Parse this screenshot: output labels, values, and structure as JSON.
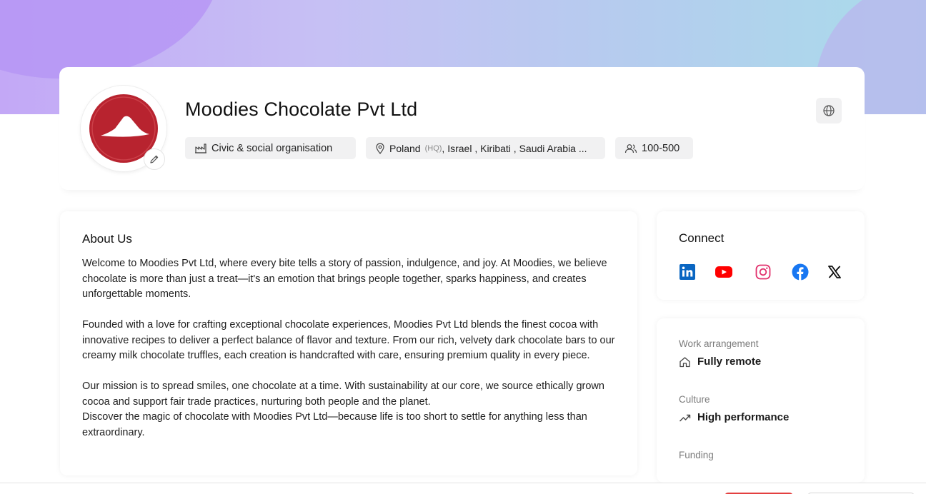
{
  "company": {
    "name": "Moodies Chocolate Pvt Ltd",
    "industry": "Civic & social organisation",
    "locations": {
      "primary": "Poland",
      "hq_tag": "(HQ)",
      "others": ", Israel , Kiribati , Saudi Arabia ..."
    },
    "size": "100-500"
  },
  "about": {
    "title": "About Us",
    "paragraphs": [
      "Welcome to Moodies Pvt Ltd, where every bite tells a story of passion, indulgence, and joy. At Moodies, we believe chocolate is more than just a treat—it's an emotion that brings people together, sparks happiness, and creates unforgettable moments.",
      "Founded with a love for crafting exceptional chocolate experiences, Moodies Pvt Ltd blends the finest cocoa with innovative recipes to deliver a perfect balance of flavor and texture. From our rich, velvety dark chocolate bars to our creamy milk chocolate truffles, each creation is handcrafted with care, ensuring premium quality in every piece.",
      "Our mission is to spread smiles, one chocolate at a time. With sustainability at our core, we source ethically grown cocoa and support fair trade practices, nurturing both people and the planet.",
      "Discover the magic of chocolate with Moodies Pvt Ltd—because life is too short to settle for anything less than extraordinary."
    ]
  },
  "connect": {
    "title": "Connect",
    "icons": [
      "linkedin-icon",
      "youtube-icon",
      "instagram-icon",
      "facebook-icon",
      "x-icon"
    ]
  },
  "info": {
    "work_arrangement_label": "Work arrangement",
    "work_arrangement_value": "Fully remote",
    "culture_label": "Culture",
    "culture_value": "High performance",
    "funding_label": "Funding"
  },
  "colors": {
    "brand_red": "#b8232f",
    "linkedin": "#0a66c2",
    "youtube": "#ff0000",
    "facebook": "#1877f2",
    "instagram": "#e1306c"
  }
}
